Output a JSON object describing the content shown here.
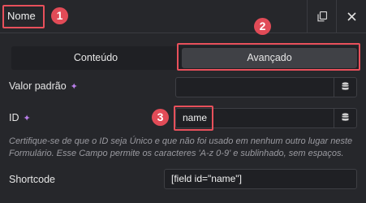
{
  "header": {
    "title": "Nome",
    "copy_icon": "copy-icon",
    "close_icon": "close-icon"
  },
  "tabs": [
    {
      "label": "Conteúdo",
      "active": false
    },
    {
      "label": "Avançado",
      "active": true
    }
  ],
  "fields": {
    "default_value": {
      "label": "Valor padrão",
      "value": ""
    },
    "id": {
      "label": "ID",
      "value": "name"
    },
    "help_text": "Certifique-se de que o ID seja Único e que não foi usado em nenhum outro lugar neste Formulário. Esse Campo permite os caracteres 'A-z 0-9' e sublinhado, sem espaços.",
    "shortcode": {
      "label": "Shortcode",
      "value": "[field id=\"name\"]"
    }
  },
  "annotations": [
    "1",
    "2",
    "3"
  ],
  "colors": {
    "accent": "#e14b57",
    "background": "#26272b",
    "sparkle": "#b87ee8"
  }
}
